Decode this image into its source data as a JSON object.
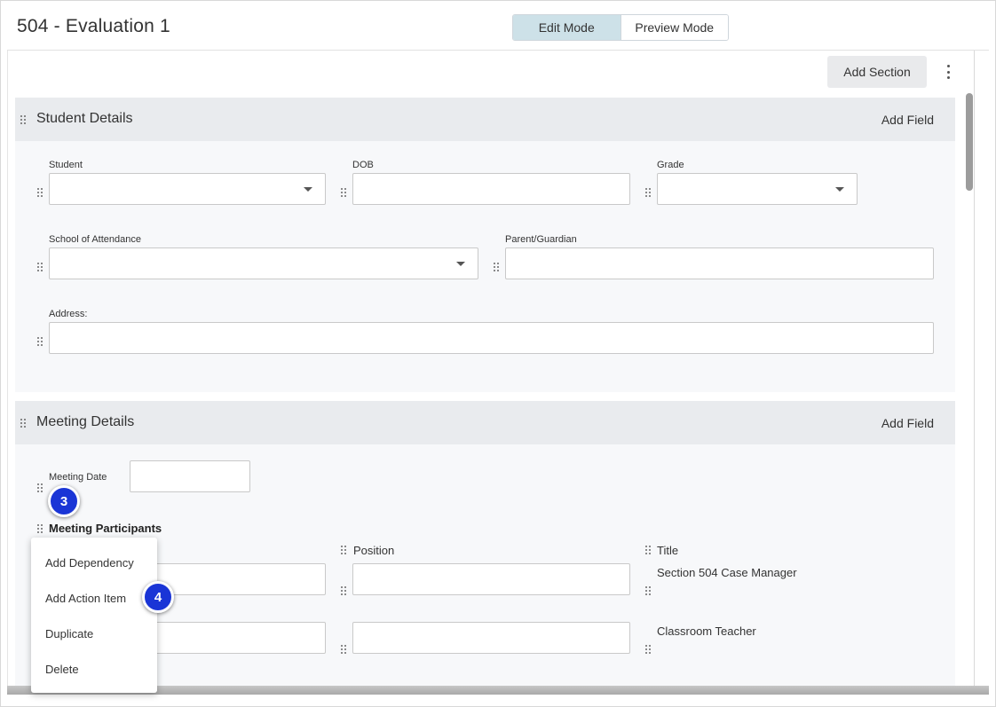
{
  "header": {
    "title": "504 - Evaluation 1",
    "modes": {
      "edit": "Edit Mode",
      "preview": "Preview Mode",
      "active": "Edit Mode"
    }
  },
  "toolbar": {
    "add_section": "Add Section",
    "more_icon": "kebab-icon"
  },
  "sections": [
    {
      "title": "Student Details",
      "add_field": "Add Field",
      "fields": {
        "student": {
          "label": "Student",
          "value": "",
          "type": "select"
        },
        "dob": {
          "label": "DOB",
          "value": "",
          "type": "text"
        },
        "grade": {
          "label": "Grade",
          "value": "",
          "type": "select"
        },
        "school": {
          "label": "School of Attendance",
          "value": "",
          "type": "select"
        },
        "parent": {
          "label": "Parent/Guardian",
          "value": "",
          "type": "text"
        },
        "address": {
          "label": "Address:",
          "value": "",
          "type": "text"
        }
      }
    },
    {
      "title": "Meeting Details",
      "add_field": "Add Field",
      "meeting_date": {
        "label": "Meeting Date",
        "value": ""
      },
      "participants": {
        "label": "Meeting Participants",
        "columns": [
          "Position",
          "Title"
        ],
        "rows": [
          {
            "name": "",
            "position": "",
            "title": "Section 504 Case Manager"
          },
          {
            "name": "",
            "position": "",
            "title": "Classroom Teacher"
          }
        ]
      }
    }
  ],
  "context_menu": {
    "items": [
      "Add Dependency",
      "Add Action Item",
      "Duplicate",
      "Delete"
    ]
  },
  "callouts": [
    "3",
    "4"
  ],
  "colors": {
    "active_mode": "#cde1e8",
    "section_header": "#e9ebee",
    "callout": "#1a35d6"
  }
}
